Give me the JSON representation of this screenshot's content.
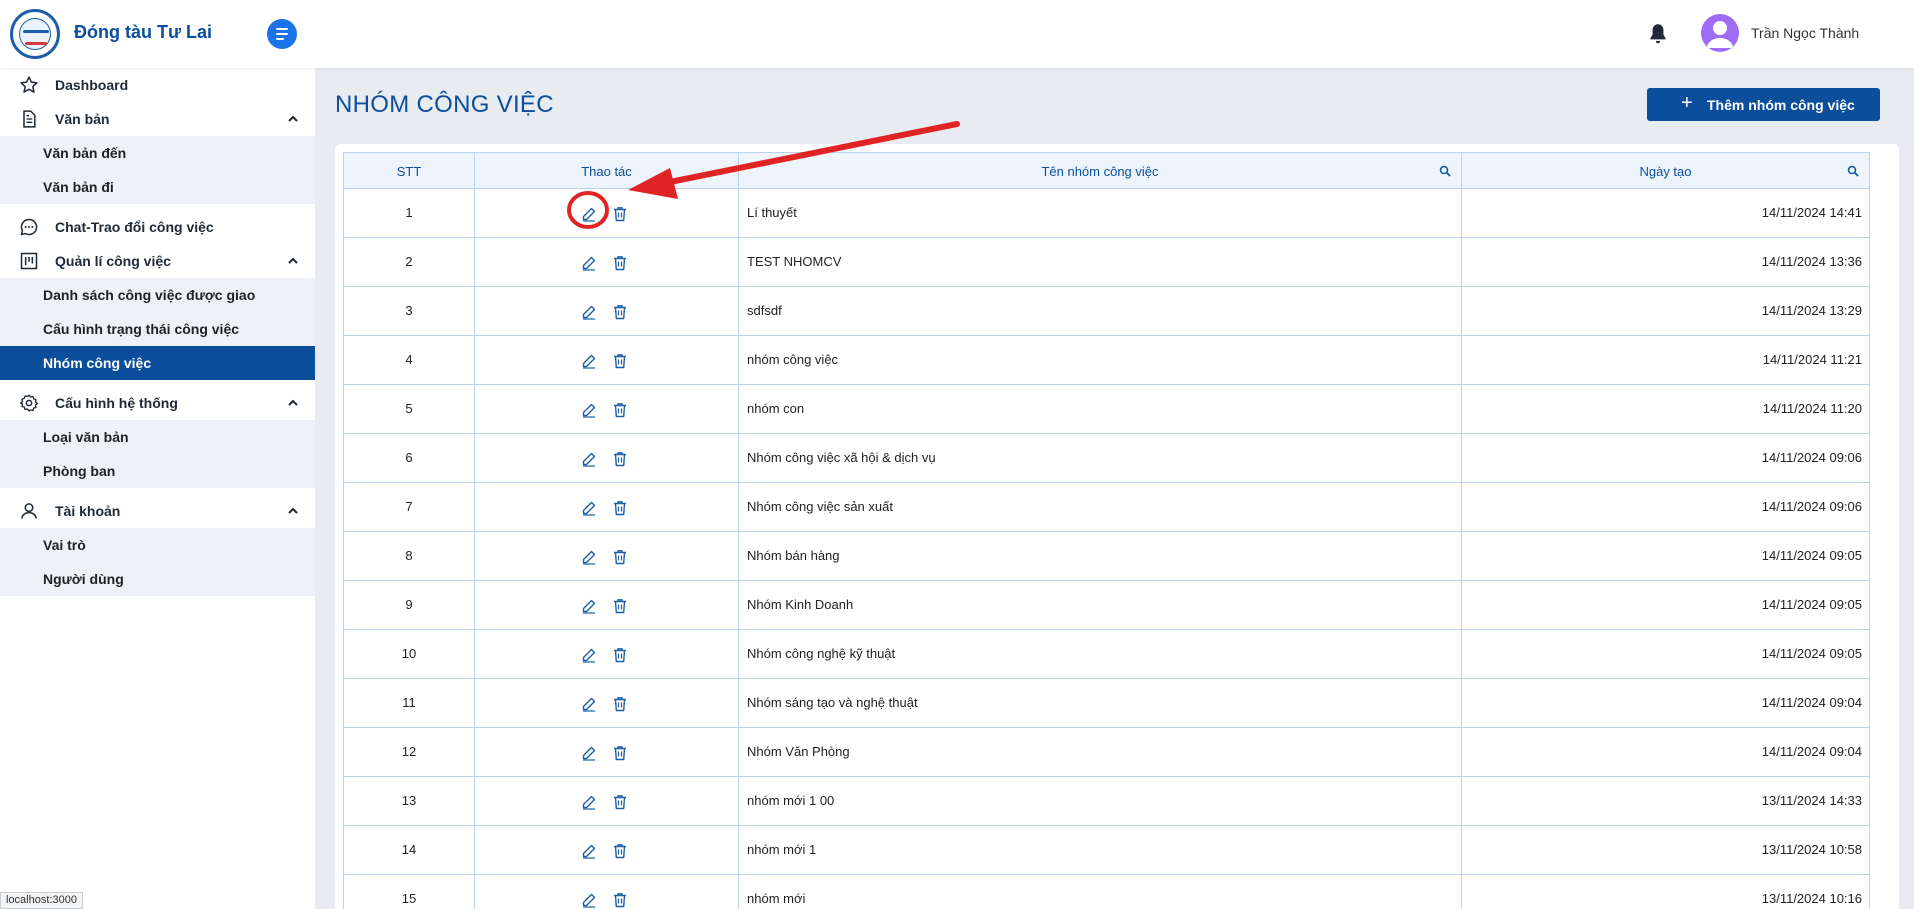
{
  "app": {
    "brand": "Đóng tàu Tư Lai",
    "user_name": "Trần Ngọc Thành"
  },
  "sidebar": {
    "items": [
      {
        "label": "Dashboard"
      },
      {
        "label": "Văn bản"
      },
      {
        "label": "Văn bản đến"
      },
      {
        "label": "Văn bản đi"
      },
      {
        "label": "Chat-Trao đổi công việc"
      },
      {
        "label": "Quản lí công việc"
      },
      {
        "label": "Danh sách công việc được giao"
      },
      {
        "label": "Cấu hình trạng thái công việc"
      },
      {
        "label": "Nhóm công việc"
      },
      {
        "label": "Cấu hình hệ thống"
      },
      {
        "label": "Loại văn bản"
      },
      {
        "label": "Phòng ban"
      },
      {
        "label": "Tài khoản"
      },
      {
        "label": "Vai trò"
      },
      {
        "label": "Người dùng"
      }
    ]
  },
  "main": {
    "title": "NHÓM CÔNG VIỆC",
    "add_button": "Thêm nhóm công việc",
    "table": {
      "headers": [
        "STT",
        "Thao tác",
        "Tên nhóm công việc",
        "Ngày tạo"
      ],
      "rows": [
        {
          "stt": "1",
          "name": "Lí thuyết",
          "date": "14/11/2024 14:41"
        },
        {
          "stt": "2",
          "name": "TEST NHOMCV",
          "date": "14/11/2024 13:36"
        },
        {
          "stt": "3",
          "name": "sdfsdf",
          "date": "14/11/2024 13:29"
        },
        {
          "stt": "4",
          "name": "nhóm công việc",
          "date": "14/11/2024 11:21"
        },
        {
          "stt": "5",
          "name": "nhóm con",
          "date": "14/11/2024 11:20"
        },
        {
          "stt": "6",
          "name": "Nhóm công việc xã hội & dịch vụ",
          "date": "14/11/2024 09:06"
        },
        {
          "stt": "7",
          "name": "Nhóm công việc sản xuất",
          "date": "14/11/2024 09:06"
        },
        {
          "stt": "8",
          "name": "Nhóm bán hàng",
          "date": "14/11/2024 09:05"
        },
        {
          "stt": "9",
          "name": "Nhóm Kinh Doanh",
          "date": "14/11/2024 09:05"
        },
        {
          "stt": "10",
          "name": "Nhóm công nghệ kỹ thuật",
          "date": "14/11/2024 09:05"
        },
        {
          "stt": "11",
          "name": "Nhóm sáng tạo và nghệ thuật",
          "date": "14/11/2024 09:04"
        },
        {
          "stt": "12",
          "name": "Nhóm Văn Phòng",
          "date": "14/11/2024 09:04"
        },
        {
          "stt": "13",
          "name": "nhóm mới 1 00",
          "date": "13/11/2024 14:33"
        },
        {
          "stt": "14",
          "name": "nhóm mới 1",
          "date": "13/11/2024 10:58"
        },
        {
          "stt": "15",
          "name": "nhóm mới",
          "date": "13/11/2024 10:16"
        }
      ]
    }
  },
  "status_bar": "localhost:3000",
  "colors": {
    "primary": "#0b4f9c",
    "accent": "#1a73e8",
    "annotation": "#e02424",
    "background": "#e8ebf0"
  },
  "icons": [
    "bell-icon",
    "user-avatar-icon",
    "star-icon",
    "document-icon",
    "chat-icon",
    "kanban-icon",
    "gear-icon",
    "person-icon",
    "chevron-up-icon",
    "edit-icon",
    "trash-icon",
    "search-icon",
    "plus-icon"
  ]
}
